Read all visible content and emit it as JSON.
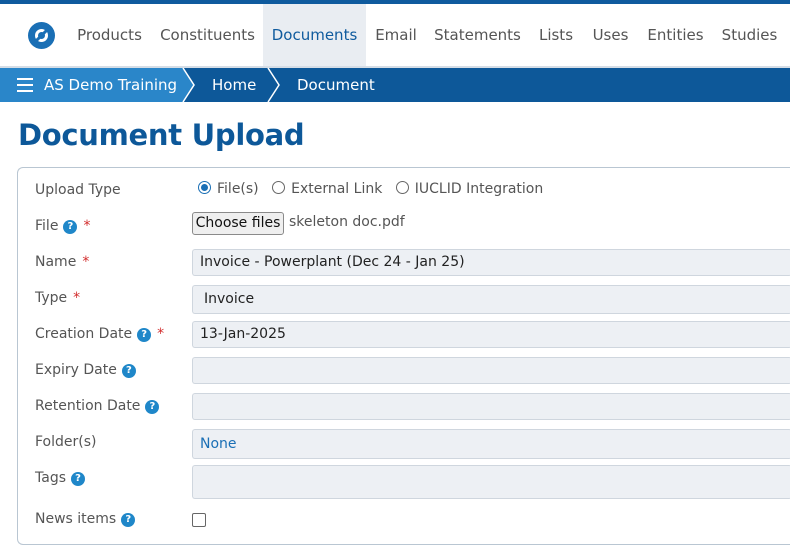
{
  "nav": {
    "items": [
      {
        "label": "Products"
      },
      {
        "label": "Constituents"
      },
      {
        "label": "Documents"
      },
      {
        "label": "Email"
      },
      {
        "label": "Statements"
      },
      {
        "label": "Lists"
      },
      {
        "label": "Uses"
      },
      {
        "label": "Entities"
      },
      {
        "label": "Studies"
      }
    ],
    "active": "Documents"
  },
  "breadcrumb": {
    "workspace": "AS Demo Training",
    "home": "Home",
    "current": "Document"
  },
  "page": {
    "title": "Document Upload"
  },
  "form": {
    "upload_type": {
      "label": "Upload Type",
      "options": [
        "File(s)",
        "External Link",
        "IUCLID Integration"
      ],
      "selected": "File(s)"
    },
    "file": {
      "label": "File",
      "button": "Choose files",
      "value": "skeleton doc.pdf"
    },
    "name": {
      "label": "Name",
      "value": "Invoice - Powerplant (Dec 24 - Jan 25)"
    },
    "type": {
      "label": "Type",
      "value": "Invoice"
    },
    "creation_date": {
      "label": "Creation Date",
      "value": "13-Jan-2025"
    },
    "expiry_date": {
      "label": "Expiry Date",
      "value": ""
    },
    "retention_date": {
      "label": "Retention Date",
      "value": ""
    },
    "folders": {
      "label": "Folder(s)",
      "value": "None"
    },
    "tags": {
      "label": "Tags",
      "value": ""
    },
    "news_items": {
      "label": "News items",
      "checked": false
    }
  },
  "symbols": {
    "required": "*",
    "help": "?"
  },
  "colors": {
    "brand": "#0d5899",
    "accent": "#2a86c9",
    "required": "#d22c2c"
  }
}
